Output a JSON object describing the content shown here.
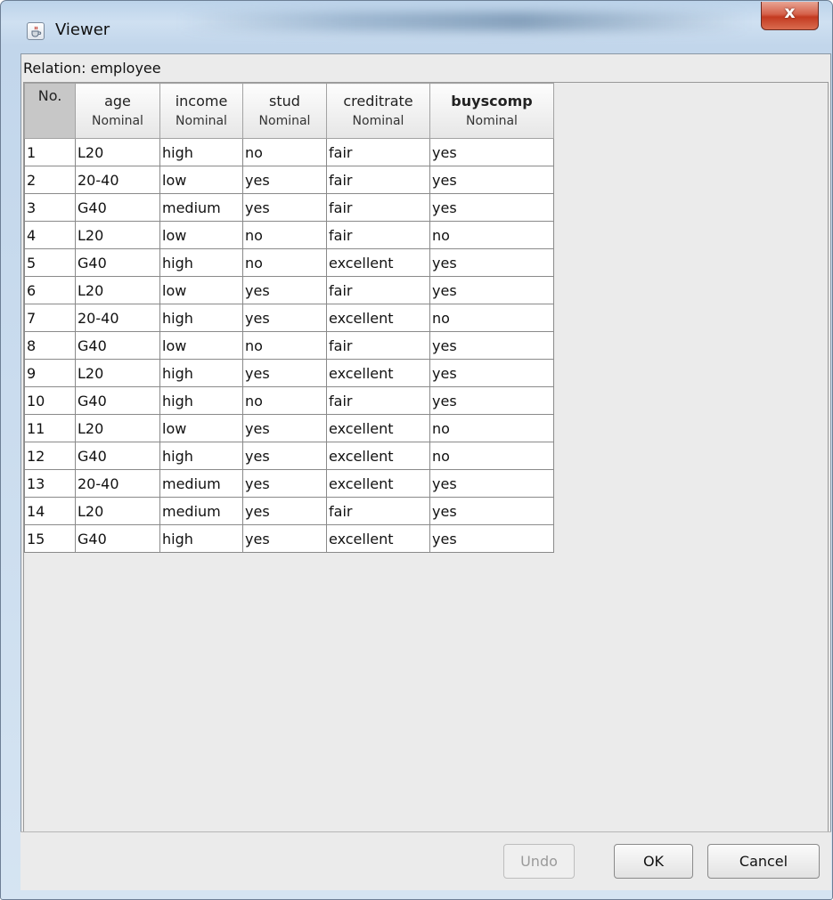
{
  "window": {
    "title": "Viewer",
    "close_glyph": "x"
  },
  "relation_label": "Relation: employee",
  "table": {
    "columns": [
      {
        "name": "No.",
        "type": ""
      },
      {
        "name": "age",
        "type": "Nominal"
      },
      {
        "name": "income",
        "type": "Nominal"
      },
      {
        "name": "stud",
        "type": "Nominal"
      },
      {
        "name": "creditrate",
        "type": "Nominal"
      },
      {
        "name": "buyscomp",
        "type": "Nominal"
      }
    ],
    "rows": [
      [
        "1",
        "L20",
        "high",
        "no",
        "fair",
        "yes"
      ],
      [
        "2",
        "20-40",
        "low",
        "yes",
        "fair",
        "yes"
      ],
      [
        "3",
        "G40",
        "medium",
        "yes",
        "fair",
        "yes"
      ],
      [
        "4",
        "L20",
        "low",
        "no",
        "fair",
        "no"
      ],
      [
        "5",
        "G40",
        "high",
        "no",
        "excellent",
        "yes"
      ],
      [
        "6",
        "L20",
        "low",
        "yes",
        "fair",
        "yes"
      ],
      [
        "7",
        "20-40",
        "high",
        "yes",
        "excellent",
        "no"
      ],
      [
        "8",
        "G40",
        "low",
        "no",
        "fair",
        "yes"
      ],
      [
        "9",
        "L20",
        "high",
        "yes",
        "excellent",
        "yes"
      ],
      [
        "10",
        "G40",
        "high",
        "no",
        "fair",
        "yes"
      ],
      [
        "11",
        "L20",
        "low",
        "yes",
        "excellent",
        "no"
      ],
      [
        "12",
        "G40",
        "high",
        "yes",
        "excellent",
        "no"
      ],
      [
        "13",
        "20-40",
        "medium",
        "yes",
        "excellent",
        "yes"
      ],
      [
        "14",
        "L20",
        "medium",
        "yes",
        "fair",
        "yes"
      ],
      [
        "15",
        "G40",
        "high",
        "yes",
        "excellent",
        "yes"
      ]
    ]
  },
  "buttons": {
    "undo": "Undo",
    "ok": "OK",
    "cancel": "Cancel"
  },
  "icons": {
    "app": "java-cup-icon",
    "close": "close-icon"
  }
}
